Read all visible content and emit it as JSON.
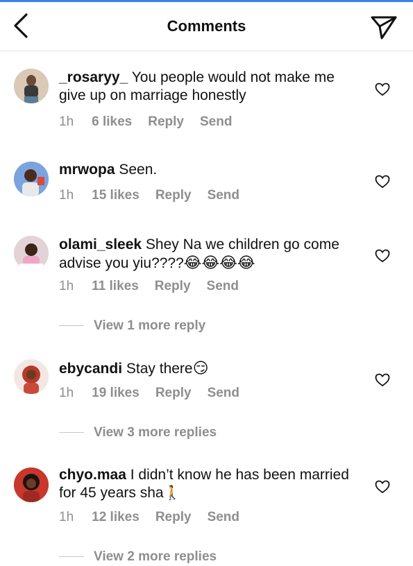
{
  "header": {
    "title": "Comments"
  },
  "icons": {
    "back": "chevron-left-icon",
    "send": "paper-plane-icon",
    "like": "heart-outline-icon"
  },
  "colors": {
    "top_line": "#3b82e6",
    "muted_text": "#8e8e8e",
    "text": "#111111"
  },
  "comments": [
    {
      "username": "_rosaryy_",
      "text": " You people would not make me give up on marriage honestly",
      "time": "1h",
      "likes": "6 likes",
      "reply": "Reply",
      "send": "Send"
    },
    {
      "username": "mrwopa",
      "text": " Seen.",
      "time": "1h",
      "likes": "15 likes",
      "reply": "Reply",
      "send": "Send"
    },
    {
      "username": "olami_sleek",
      "text": " Shey Na we children go come advise you yiu????",
      "emojis": "😂😂😂😂",
      "time": "1h",
      "likes": "11 likes",
      "reply": "Reply",
      "send": "Send",
      "more_replies": "View 1 more reply"
    },
    {
      "username": "ebycandi",
      "text": " Stay there",
      "emojis": "😏",
      "time": "1h",
      "likes": "19 likes",
      "reply": "Reply",
      "send": "Send",
      "more_replies": "View 3 more replies"
    },
    {
      "username": "chyo.maa",
      "text": " I didn’t know he has been married for 45 years sha",
      "emojis": "🚶",
      "time": "1h",
      "likes": "12 likes",
      "reply": "Reply",
      "send": "Send",
      "more_replies": "View 2 more replies"
    }
  ]
}
